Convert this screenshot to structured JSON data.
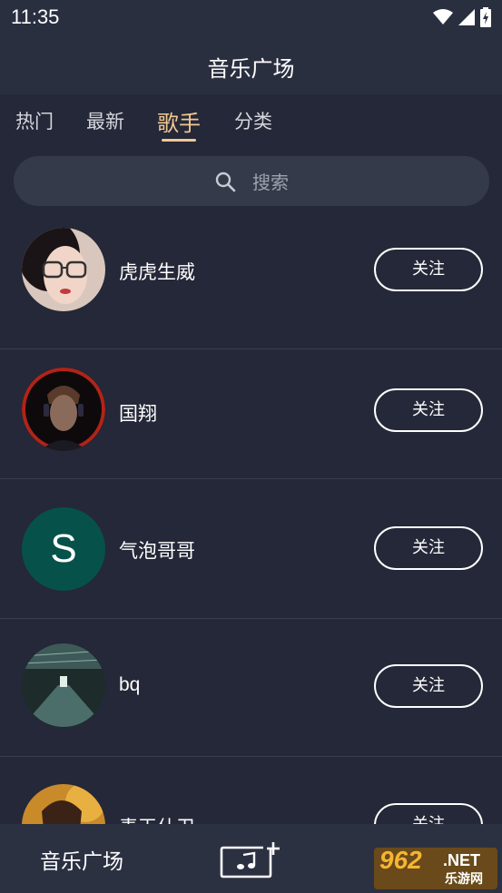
{
  "status": {
    "time": "11:35"
  },
  "header": {
    "title": "音乐广场"
  },
  "tabs": [
    {
      "label": "热门"
    },
    {
      "label": "最新"
    },
    {
      "label": "歌手",
      "active": true
    },
    {
      "label": "分类"
    }
  ],
  "search": {
    "placeholder": "搜索"
  },
  "singers": [
    {
      "name": "虎虎生威",
      "follow_label": "关注",
      "avatar": "photo-woman-glasses"
    },
    {
      "name": "国翔",
      "follow_label": "关注",
      "avatar": "photo-man-headphones"
    },
    {
      "name": "气泡哥哥",
      "follow_label": "关注",
      "avatar_letter": "S",
      "avatar_color": "#06524a"
    },
    {
      "name": "bq",
      "follow_label": "关注",
      "avatar": "photo-train-station"
    },
    {
      "name": "毒王什卫",
      "follow_label": "关注",
      "avatar": "photo-woman-autumn"
    }
  ],
  "bottom_nav": {
    "label": "音乐广场",
    "center_icon": "music-add-icon"
  },
  "watermark": {
    "big": "962",
    "net": ".NET",
    "sub": "乐游网"
  },
  "colors": {
    "accent": "#f2c792",
    "background": "#242838",
    "header": "#2a2f40"
  }
}
